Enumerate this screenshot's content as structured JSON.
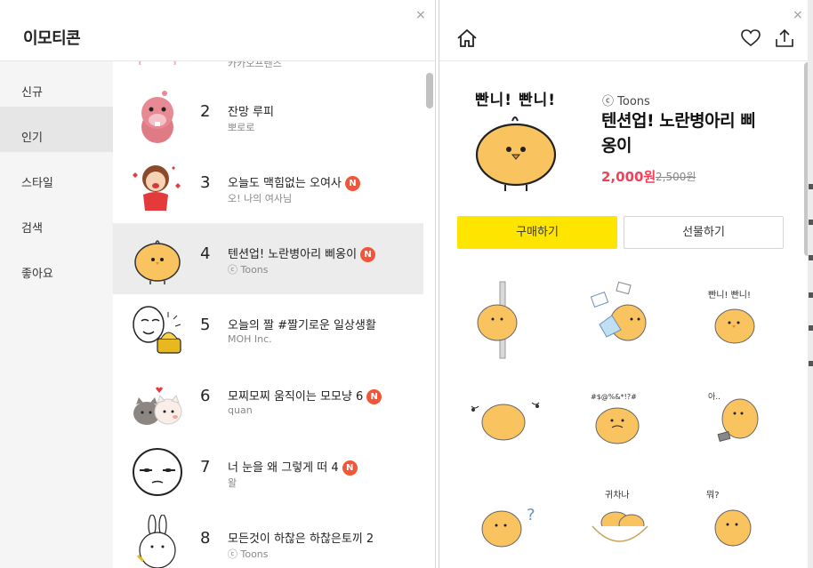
{
  "left": {
    "title": "이모티콘",
    "close": "×",
    "nav": [
      {
        "label": "신규"
      },
      {
        "label": "인기"
      },
      {
        "label": "스타일"
      },
      {
        "label": "검색"
      },
      {
        "label": "좋아요"
      }
    ],
    "partial_top_sub": "카카오프렌즈",
    "rows": [
      {
        "rank": "2",
        "title": "잔망 루피",
        "sub": "뽀로로",
        "is_new": false
      },
      {
        "rank": "3",
        "title": "오늘도 맥힘없는 오여사",
        "sub": "오! 나의 여사님",
        "is_new": true
      },
      {
        "rank": "4",
        "title": "텐션업! 노란병아리 삐옹이",
        "sub": "ⓒ Toons",
        "is_new": true
      },
      {
        "rank": "5",
        "title": "오늘의 짤 #짤기로운 일상생활",
        "sub": "MOH Inc.",
        "is_new": false
      },
      {
        "rank": "6",
        "title": "모찌모찌 움직이는 모모냥 6",
        "sub": "quan",
        "is_new": true
      },
      {
        "rank": "7",
        "title": "너 눈을 왜 그렇게 떠 4",
        "sub": "왈",
        "is_new": true
      },
      {
        "rank": "8",
        "title": "모든것이 하찮은 하찮은토끼 2",
        "sub": "ⓒ Toons",
        "is_new": false
      }
    ],
    "new_badge": "N"
  },
  "right": {
    "close": "×",
    "hero_text": "빤니! 빤니!",
    "author": "ⓒ Toons",
    "title_line1": "텐션업! 노란병아리 삐",
    "title_line2": "옹이",
    "price": "2,000원",
    "old_price": "2,500원",
    "buy_label": "구매하기",
    "gift_label": "선물하기",
    "grid_texts": {
      "c3": "빤니! 빤니!",
      "c5": "#$@%&*!?#",
      "c6": "아..",
      "c8": "귀차나",
      "c9": "뭐?"
    }
  },
  "colors": {
    "accent_yellow": "#fee500",
    "badge_red": "#f2553a",
    "price_red": "#f2415a",
    "chick_yellow": "#f9c460",
    "active_row": "#ececec"
  }
}
